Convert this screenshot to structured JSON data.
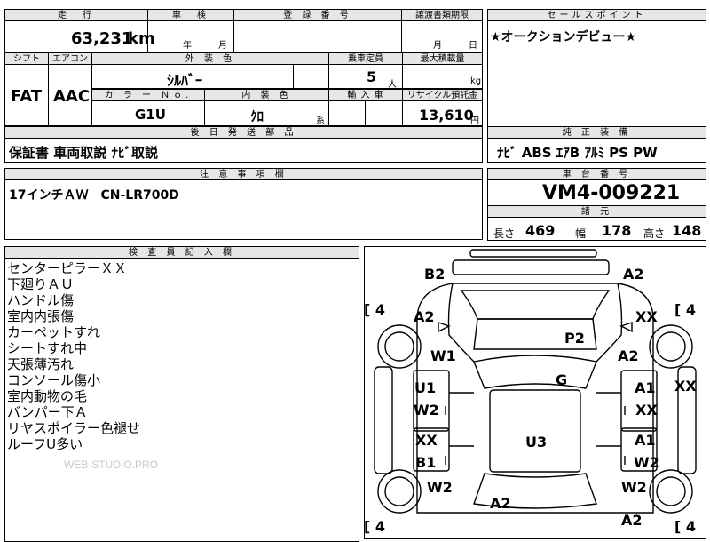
{
  "header": {
    "mileage_label": "走　行",
    "inspection_label": "車　検",
    "reg_label": "登 録 番 号",
    "transfer_label": "譲渡書類期限",
    "sales_label": "セールスポイント",
    "mileage_value": "63,231",
    "mileage_unit": "km",
    "inspection_year": "年",
    "inspection_month": "月",
    "transfer_month": "月",
    "transfer_day": "日",
    "sales_point": "★オークションデビュー★"
  },
  "spec": {
    "shift_label": "シフト",
    "ac_label": "エアコン",
    "exterior_label": "外 装 色",
    "capacity_label": "乗車定員",
    "load_label": "最大積載量",
    "shift": "FAT",
    "ac": "AAC",
    "exterior_color": "ｼﾙﾊﾞｰ",
    "capacity": "5",
    "capacity_unit": "人",
    "load_unit": "kg",
    "color_no_label": "カ ラ ー Ｎｏ.",
    "interior_label": "内 装 色",
    "import_label": "輸 入 車",
    "recycle_label": "リサイクル預託金",
    "color_no": "G1U",
    "interior": "ｸﾛ",
    "interior_suffix": "系",
    "recycle": "13,610",
    "recycle_unit": "円"
  },
  "later": {
    "label": "後 日 発 送 部 品",
    "value": "保証書 車両取説 ﾅﾋﾞ取説"
  },
  "equipment": {
    "label": "純 正 装 備",
    "value": "ﾅﾋﾞ ABS ｴｱB ｱﾙﾐ PS PW"
  },
  "caution": {
    "label": "注 意 事 項 欄",
    "value": "17インチＡＷ　CN-LR700D"
  },
  "chassis": {
    "label": "車 台 番 号",
    "value": "VM4-009221"
  },
  "dims": {
    "label": "諸 元",
    "length_label": "長さ",
    "length": "469",
    "width_label": "幅",
    "width": "178",
    "height_label": "高さ",
    "height": "148"
  },
  "inspector": {
    "label": "検 査 員 記 入 欄",
    "notes": [
      "センターピラーＸＸ",
      "下廻りＡＵ",
      "ハンドル傷",
      "室内内張傷",
      "カーペットすれ",
      "シートすれ中",
      "天張薄汚れ",
      "コンソール傷小",
      "室内動物の毛",
      "バンパー下Ａ",
      "リヤスポイラー色褪せ",
      "ルーフU多い"
    ]
  },
  "watermark": "WEB-STUDIO.PRO",
  "diagram": {
    "marks": {
      "front_left": "B2",
      "front_right": "A2",
      "fender_fl": "A2",
      "fender_fr": "XX",
      "hood": "P2",
      "wiper": "W1",
      "fr_right_a2": "A2",
      "roof": "G",
      "left_u1": "U1",
      "left_w2": "W2",
      "right_a1": "A1",
      "right_xx": "XX",
      "far_right_xx": "XX",
      "rear_left_xx": "XX",
      "trunk_u3": "U3",
      "rear_right_a1": "A1",
      "rear_left_b1": "B1",
      "rear_right_w2": "W2",
      "rl_w2": "W2",
      "rr_w2": "W2",
      "bottom_a2": "A2",
      "bottom_right_a2": "A2"
    },
    "tire_tl": "4",
    "tire_tr": "4",
    "tire_bl": "4",
    "tire_br": "4"
  }
}
